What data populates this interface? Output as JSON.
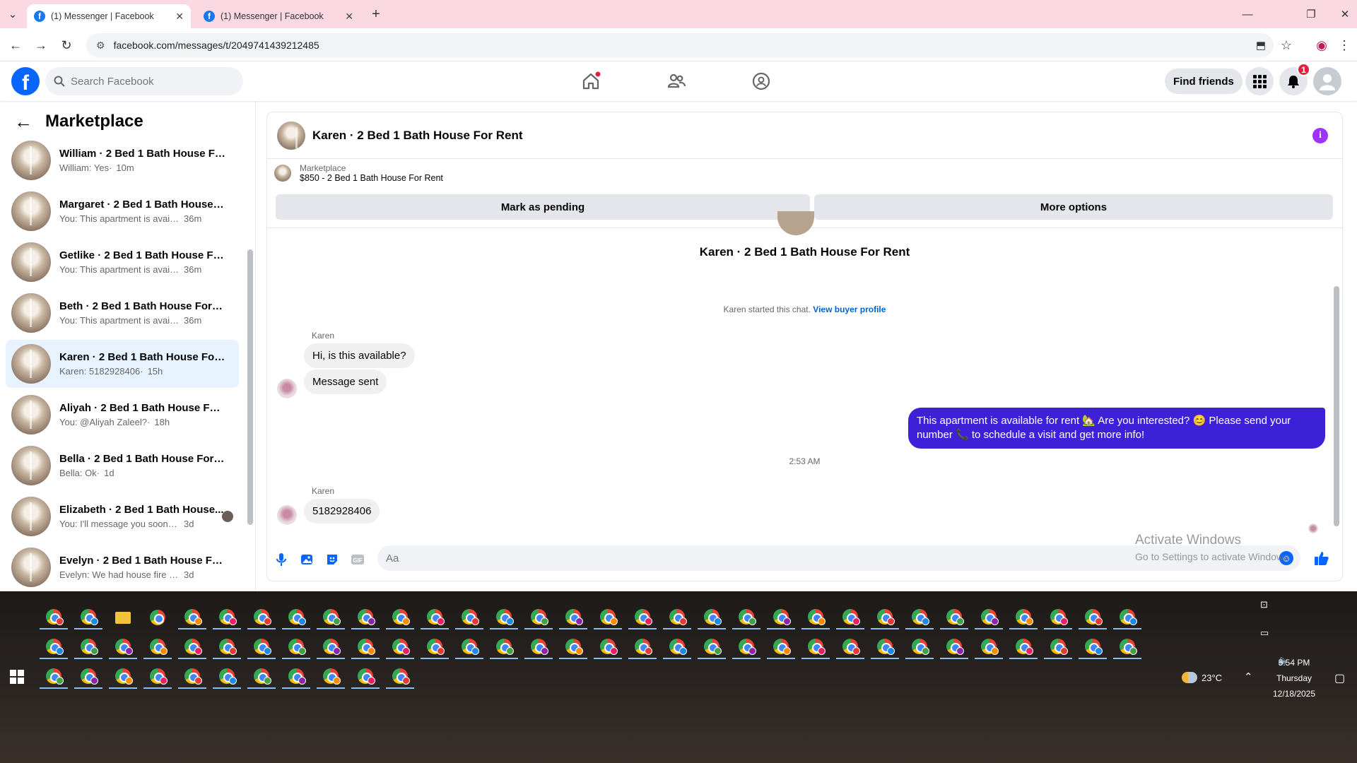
{
  "browser": {
    "tabs": [
      {
        "title": "(1) Messenger | Facebook",
        "active": true
      },
      {
        "title": "(1) Messenger | Facebook",
        "active": false
      }
    ],
    "url": "facebook.com/messages/t/2049741439212485"
  },
  "fb_header": {
    "search_placeholder": "Search Facebook",
    "find_friends": "Find friends",
    "notifications_count": "1"
  },
  "sidebar": {
    "title": "Marketplace",
    "conversations": [
      {
        "name": "William · 2 Bed 1 Bath House For...",
        "snippet": "William: Yes",
        "time": "10m"
      },
      {
        "name": "Margaret · 2 Bed 1 Bath House F...",
        "snippet": "You: This apartment is available f...",
        "time": "36m"
      },
      {
        "name": "Getlike · 2 Bed 1 Bath House For ...",
        "snippet": "You: This apartment is available f...",
        "time": "36m"
      },
      {
        "name": "Beth · 2 Bed 1 Bath House For R...",
        "snippet": "You: This apartment is available f...",
        "time": "36m"
      },
      {
        "name": "Karen · 2 Bed 1 Bath House For ...",
        "snippet": "Karen: 5182928406",
        "time": "15h"
      },
      {
        "name": "Aliyah · 2 Bed 1 Bath House For ...",
        "snippet": "You: @Aliyah Zaleel?",
        "time": "18h"
      },
      {
        "name": "Bella · 2 Bed 1 Bath House For R...",
        "snippet": "Bella: Ok",
        "time": "1d"
      },
      {
        "name": "Elizabeth · 2 Bed 1 Bath House...",
        "snippet": "You: I'll message you soon. If yo...",
        "time": "3d"
      },
      {
        "name": "Evelyn · 2 Bed 1 Bath House For ...",
        "snippet": "Evelyn: We had house fire looking t...",
        "time": "3d"
      }
    ]
  },
  "chat": {
    "title": "Karen · 2 Bed 1 Bath House For Rent",
    "listing_source": "Marketplace",
    "listing_title": "$850 - 2 Bed 1 Bath House For Rent",
    "mark_pending": "Mark as pending",
    "more_options": "More options",
    "top_name": "Karen · 2 Bed 1 Bath House For Rent",
    "started_text": "Karen started this chat.",
    "view_buyer": "View buyer profile",
    "sender": "Karen",
    "msg1": "Hi, is this available?",
    "msg2": "Message sent",
    "outgoing": "This apartment is available for rent 🏡 Are you interested? 😊 Please send your number 📞 to schedule a visit and get more info!",
    "timestamp": "2:53 AM",
    "msg3": "5182928406",
    "input_placeholder": "Aa"
  },
  "watermark": {
    "line1": "Activate Windows",
    "line2": "Go to Settings to activate Windows."
  },
  "taskbar": {
    "temperature": "23°C",
    "time": "5:54 PM",
    "day": "Thursday",
    "date": "12/18/2025"
  },
  "colors": {
    "fb_blue": "#0866ff",
    "outgoing_bubble": "#3d21d8",
    "selected_row": "#e7f3ff"
  }
}
